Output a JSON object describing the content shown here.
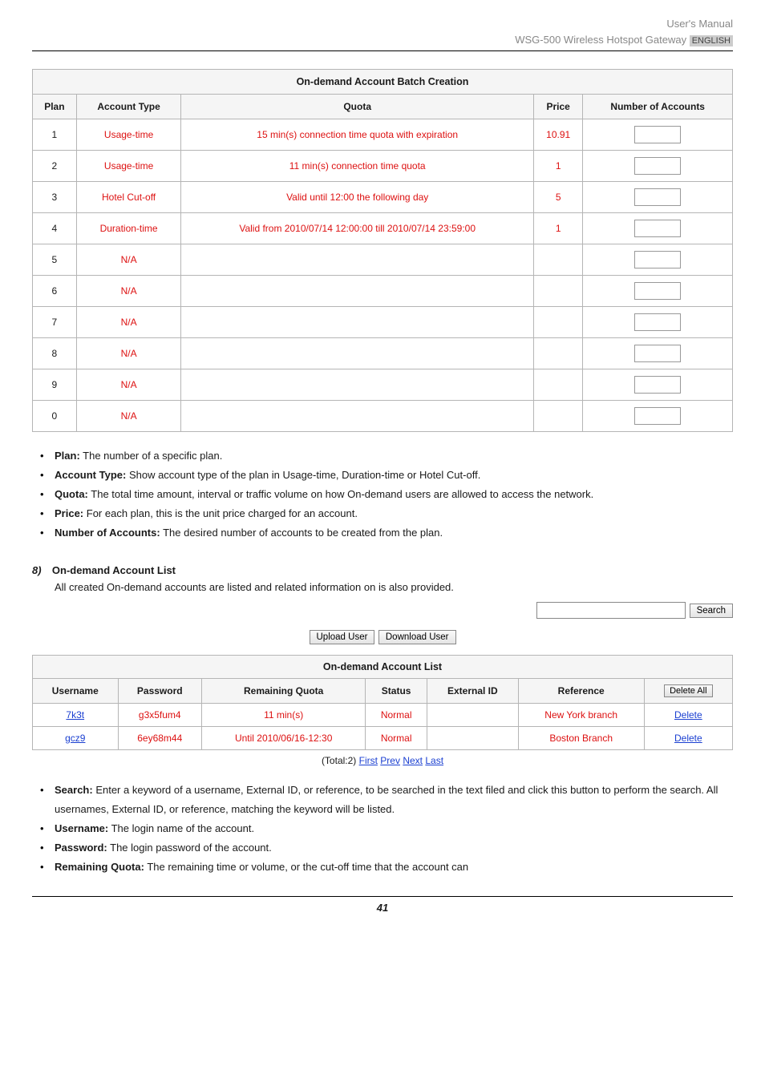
{
  "header": {
    "line1": "User's Manual",
    "line2_prefix": "WSG-500 Wireless Hotspot Gateway ",
    "line2_badge": "ENGLISH"
  },
  "batch_table": {
    "caption": "On-demand Account Batch Creation",
    "headers": {
      "plan": "Plan",
      "account_type": "Account Type",
      "quota": "Quota",
      "price": "Price",
      "number_of_accounts": "Number of Accounts"
    },
    "rows": [
      {
        "plan": "1",
        "account_type": "Usage-time",
        "quota": "15 min(s) connection time quota with expiration",
        "price": "10.91"
      },
      {
        "plan": "2",
        "account_type": "Usage-time",
        "quota": "11 min(s) connection time quota",
        "price": "1"
      },
      {
        "plan": "3",
        "account_type": "Hotel Cut-off",
        "quota": "Valid until 12:00 the following day",
        "price": "5"
      },
      {
        "plan": "4",
        "account_type": "Duration-time",
        "quota": "Valid from 2010/07/14 12:00:00 till 2010/07/14 23:59:00",
        "price": "1"
      },
      {
        "plan": "5",
        "account_type": "N/A",
        "quota": "",
        "price": ""
      },
      {
        "plan": "6",
        "account_type": "N/A",
        "quota": "",
        "price": ""
      },
      {
        "plan": "7",
        "account_type": "N/A",
        "quota": "",
        "price": ""
      },
      {
        "plan": "8",
        "account_type": "N/A",
        "quota": "",
        "price": ""
      },
      {
        "plan": "9",
        "account_type": "N/A",
        "quota": "",
        "price": ""
      },
      {
        "plan": "0",
        "account_type": "N/A",
        "quota": "",
        "price": ""
      }
    ]
  },
  "bullets1": [
    {
      "label": "Plan:",
      "text": " The number of a specific plan."
    },
    {
      "label": "Account Type:",
      "text": " Show account type of the plan in Usage-time, Duration-time or Hotel Cut-off."
    },
    {
      "label": "Quota:",
      "text": " The total time amount, interval or traffic volume on how On-demand users are allowed to access the network."
    },
    {
      "label": "Price:",
      "text": " For each plan, this is the unit price charged for an account."
    },
    {
      "label": "Number of Accounts:",
      "text": " The desired number of accounts to be created from the plan."
    }
  ],
  "section": {
    "num": "8)",
    "title": "On-demand Account List",
    "intro": "All created On-demand accounts are listed and related information on is also provided."
  },
  "buttons": {
    "search": "Search",
    "upload": "Upload User",
    "download": "Download User",
    "delete_all": "Delete All"
  },
  "list_table": {
    "caption": "On-demand Account List",
    "headers": {
      "username": "Username",
      "password": "Password",
      "remaining": "Remaining Quota",
      "status": "Status",
      "external_id": "External ID",
      "reference": "Reference"
    },
    "rows": [
      {
        "username": "7k3t",
        "password": "g3x5fum4",
        "remaining": "11 min(s)",
        "status": "Normal",
        "external_id": "",
        "reference": "New York branch",
        "action": "Delete"
      },
      {
        "username": "gcz9",
        "password": "6ey68m44",
        "remaining": "Until 2010/06/16-12:30",
        "status": "Normal",
        "external_id": "",
        "reference": "Boston Branch",
        "action": "Delete"
      }
    ]
  },
  "pager": {
    "total": "(Total:2) ",
    "first": "First",
    "prev": "Prev",
    "next": "Next",
    "last": "Last"
  },
  "bullets2": [
    {
      "label": "Search:",
      "text": " Enter a keyword of a username, External ID, or reference, to be searched in the text filed and click this button to perform the search. All usernames, External ID, or reference, matching the keyword will be listed."
    },
    {
      "label": "Username:",
      "text": " The login name of the account."
    },
    {
      "label": "Password:",
      "text": " The login password of the account."
    },
    {
      "label": "Remaining Quota:",
      "text": " The remaining time or volume, or the cut-off time that the account can"
    }
  ],
  "page_number": "41"
}
